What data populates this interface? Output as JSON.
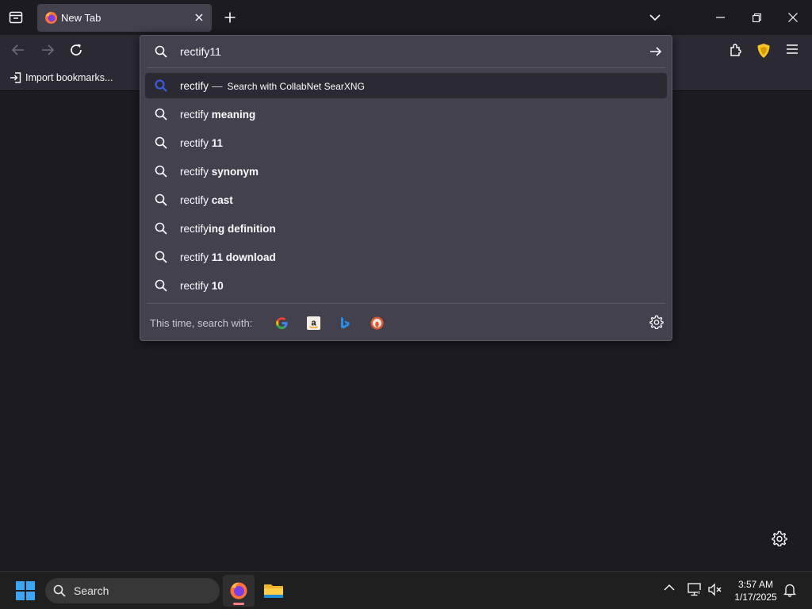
{
  "tab": {
    "title": "New Tab"
  },
  "bookmarks": {
    "import_label": "Import bookmarks..."
  },
  "urlbar": {
    "value": "rectify11"
  },
  "results": [
    {
      "prefix": "rectify",
      "bold": "",
      "action": "Search with CollabNet SearXNG",
      "separator": "—",
      "selected": true
    },
    {
      "prefix": "rectify ",
      "bold": "meaning"
    },
    {
      "prefix": "rectify ",
      "bold": "11"
    },
    {
      "prefix": "rectify ",
      "bold": "synonym"
    },
    {
      "prefix": "rectify ",
      "bold": "cast"
    },
    {
      "prefix": "rectify",
      "bold": "ing definition"
    },
    {
      "prefix": "rectify ",
      "bold": "11 download"
    },
    {
      "prefix": "rectify ",
      "bold": "10"
    }
  ],
  "oneoff": {
    "label": "This time, search with:",
    "engines": [
      "google-icon",
      "amazon-icon",
      "bing-icon",
      "duckduckgo-icon"
    ]
  },
  "taskbar": {
    "search_label": "Search",
    "time": "3:57 AM",
    "date": "1/17/2025"
  },
  "colors": {
    "accent_blue": "#3b5bdb",
    "windows_blue": "#3fa6f5"
  }
}
